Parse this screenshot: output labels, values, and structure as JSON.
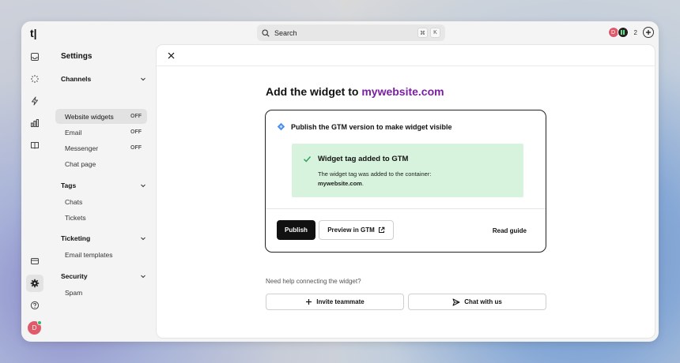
{
  "app": {
    "logo": "t|"
  },
  "search": {
    "placeholder": "Search",
    "shortcut_keys": [
      "⌘",
      "K"
    ]
  },
  "top_right": {
    "avatar_initial": "D",
    "count": "2"
  },
  "rail": {
    "icons": [
      "inbox-icon",
      "sparkle-icon",
      "lightning-icon",
      "analytics-icon",
      "book-icon",
      "billing-icon",
      "gear-icon",
      "help-icon"
    ],
    "avatar_initial": "D"
  },
  "sidebar": {
    "title": "Settings",
    "sections": [
      {
        "label": "Channels",
        "items": [
          {
            "label": "Website widgets",
            "badge": "OFF",
            "active": true
          },
          {
            "label": "Email",
            "badge": "OFF"
          },
          {
            "label": "Messenger",
            "badge": "OFF"
          },
          {
            "label": "Chat page",
            "badge": ""
          }
        ]
      },
      {
        "label": "Tags",
        "items": [
          {
            "label": "Chats"
          },
          {
            "label": "Tickets"
          }
        ]
      },
      {
        "label": "Ticketing",
        "items": [
          {
            "label": "Email templates"
          }
        ]
      },
      {
        "label": "Security",
        "items": [
          {
            "label": "Spam"
          }
        ]
      }
    ]
  },
  "main": {
    "heading_prefix": "Add the widget to ",
    "heading_site": "mywebsite.com",
    "card": {
      "title": "Publish the GTM version to make widget visible",
      "success_title": "Widget tag added to GTM",
      "success_text": "The widget tag was added to the container:",
      "success_container": "mywebsite.com",
      "success_suffix": ".",
      "publish_label": "Publish",
      "preview_label": "Preview in GTM",
      "read_guide_label": "Read guide"
    },
    "help_text": "Need help connecting the widget?",
    "invite_label": "Invite teammate",
    "chat_label": "Chat with us"
  },
  "colors": {
    "accent_site": "#7b1fa2",
    "success_bg": "#d7f3dd",
    "success_check": "#2e9e57",
    "primary_button": "#111111"
  }
}
